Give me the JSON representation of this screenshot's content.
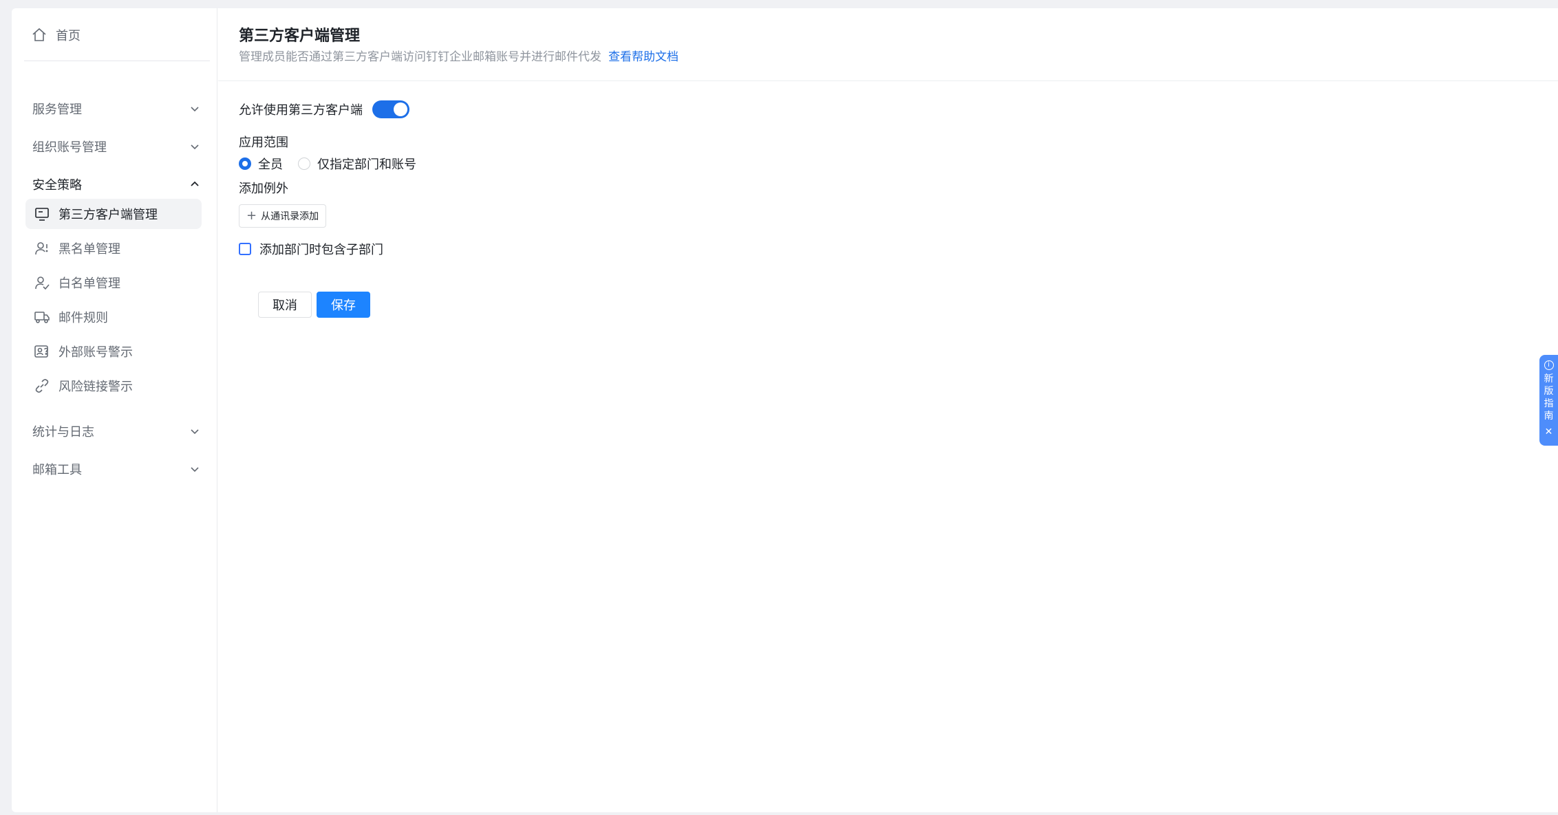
{
  "sidebar": {
    "home": "首页",
    "groups": {
      "service": "服务管理",
      "org": "组织账号管理",
      "security": "安全策略",
      "stats": "统计与日志",
      "tools": "邮箱工具"
    },
    "items": {
      "third_party": "第三方客户端管理",
      "blacklist": "黑名单管理",
      "whitelist": "白名单管理",
      "mail_rules": "邮件规则",
      "external_warn": "外部账号警示",
      "risk_link": "风险链接警示"
    }
  },
  "main": {
    "title": "第三方客户端管理",
    "subtitle": "管理成员能否通过第三方客户端访问钉钉企业邮箱账号并进行邮件代发",
    "help_link": "查看帮助文档",
    "allow_label": "允许使用第三方客户端",
    "allow_enabled": true,
    "scope_label": "应用范围",
    "scope_all": "全员",
    "scope_specific": "仅指定部门和账号",
    "scope_selected": "all",
    "exception_label": "添加例外",
    "add_from_contacts": "从通讯录添加",
    "include_sub_label": "添加部门时包含子部门",
    "include_sub_checked": false,
    "cancel": "取消",
    "save": "保存"
  },
  "guide": {
    "label": "新版指南"
  },
  "colors": {
    "accent": "#1d6fe8",
    "primary_button": "#1d84ff",
    "guide_tab": "#4e8dfb"
  }
}
